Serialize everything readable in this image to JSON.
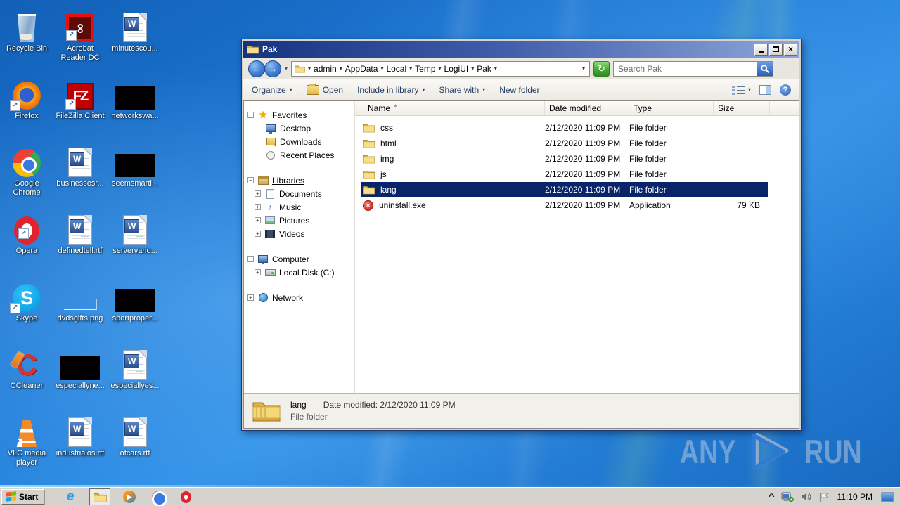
{
  "desktop": {
    "icons": [
      {
        "label": "Recycle Bin",
        "icon": "recycle-bin-icon"
      },
      {
        "label": "Acrobat Reader DC",
        "icon": "acrobat-icon"
      },
      {
        "label": "minutescou...",
        "icon": "word-doc-icon"
      },
      {
        "label": "Firefox",
        "icon": "firefox-icon"
      },
      {
        "label": "FileZilla Client",
        "icon": "filezilla-icon"
      },
      {
        "label": "networkswa...",
        "icon": "black-thumbnail-icon"
      },
      {
        "label": "Google Chrome",
        "icon": "chrome-icon"
      },
      {
        "label": "businessesr...",
        "icon": "word-doc-icon"
      },
      {
        "label": "seemsmarti...",
        "icon": "black-thumbnail-icon"
      },
      {
        "label": "Opera",
        "icon": "opera-icon"
      },
      {
        "label": "definedtell.rtf",
        "icon": "word-doc-icon"
      },
      {
        "label": "servervario...",
        "icon": "word-doc-icon"
      },
      {
        "label": "Skype",
        "icon": "skype-icon"
      },
      {
        "label": "dvdsgifts.png",
        "icon": "image-thumbnail-icon"
      },
      {
        "label": "sportproper...",
        "icon": "black-thumbnail-icon"
      },
      {
        "label": "CCleaner",
        "icon": "ccleaner-icon"
      },
      {
        "label": "especiallyne...",
        "icon": "black-thumbnail-icon"
      },
      {
        "label": "especiallyes...",
        "icon": "word-doc-icon"
      },
      {
        "label": "VLC media player",
        "icon": "vlc-icon"
      },
      {
        "label": "industrialos.rtf",
        "icon": "word-doc-icon"
      },
      {
        "label": "ofcars.rtf",
        "icon": "word-doc-icon"
      }
    ]
  },
  "explorer": {
    "title": "Pak",
    "breadcrumbs": [
      "admin",
      "AppData",
      "Local",
      "Temp",
      "LogiUI",
      "Pak"
    ],
    "search_placeholder": "Search Pak",
    "toolbar": {
      "organize": "Organize",
      "open": "Open",
      "include": "Include in library",
      "share": "Share with",
      "new_folder": "New folder"
    },
    "nav": {
      "favorites": {
        "label": "Favorites",
        "items": [
          "Desktop",
          "Downloads",
          "Recent Places"
        ]
      },
      "libraries": {
        "label": "Libraries",
        "items": [
          "Documents",
          "Music",
          "Pictures",
          "Videos"
        ]
      },
      "computer": {
        "label": "Computer",
        "items": [
          "Local Disk (C:)"
        ]
      },
      "network": {
        "label": "Network"
      }
    },
    "columns": [
      "Name",
      "Date modified",
      "Type",
      "Size"
    ],
    "files": [
      {
        "name": "css",
        "date": "2/12/2020 11:09 PM",
        "type": "File folder",
        "size": ""
      },
      {
        "name": "html",
        "date": "2/12/2020 11:09 PM",
        "type": "File folder",
        "size": ""
      },
      {
        "name": "img",
        "date": "2/12/2020 11:09 PM",
        "type": "File folder",
        "size": ""
      },
      {
        "name": "js",
        "date": "2/12/2020 11:09 PM",
        "type": "File folder",
        "size": ""
      },
      {
        "name": "lang",
        "date": "2/12/2020 11:09 PM",
        "type": "File folder",
        "size": ""
      },
      {
        "name": "uninstall.exe",
        "date": "2/12/2020 11:09 PM",
        "type": "Application",
        "size": "79 KB"
      }
    ],
    "details": {
      "name": "lang",
      "modified": "Date modified: 2/12/2020 11:09 PM",
      "type": "File folder"
    }
  },
  "taskbar": {
    "start": "Start",
    "clock": "11:10 PM"
  },
  "watermark": {
    "left": "ANY",
    "right": "RUN"
  },
  "colors": {
    "selection": "#0A246A",
    "titlebar_left": "#16337F",
    "titlebar_right": "#8FA6D9",
    "desktop_blue": "#1E7AD6"
  }
}
